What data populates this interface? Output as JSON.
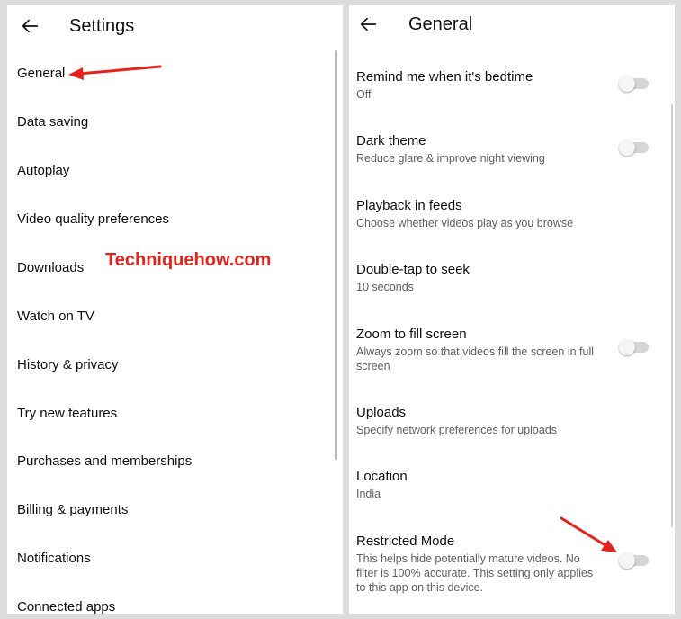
{
  "left": {
    "title": "Settings",
    "items": [
      {
        "label": "General"
      },
      {
        "label": "Data saving"
      },
      {
        "label": "Autoplay"
      },
      {
        "label": "Video quality preferences"
      },
      {
        "label": "Downloads"
      },
      {
        "label": "Watch on TV"
      },
      {
        "label": "History & privacy"
      },
      {
        "label": "Try new features"
      },
      {
        "label": "Purchases and memberships"
      },
      {
        "label": "Billing & payments"
      },
      {
        "label": "Notifications"
      },
      {
        "label": "Connected apps"
      }
    ]
  },
  "right": {
    "title": "General",
    "settings": [
      {
        "title": "Remind me when it's bedtime",
        "subtitle": "Off"
      },
      {
        "title": "Dark theme",
        "subtitle": "Reduce glare & improve night viewing"
      },
      {
        "title": "Playback in feeds",
        "subtitle": "Choose whether videos play as you browse"
      },
      {
        "title": "Double-tap to seek",
        "subtitle": "10 seconds"
      },
      {
        "title": "Zoom to fill screen",
        "subtitle": "Always zoom so that videos fill the screen in full screen"
      },
      {
        "title": "Uploads",
        "subtitle": "Specify network preferences for uploads"
      },
      {
        "title": "Location",
        "subtitle": "India"
      },
      {
        "title": "Restricted Mode",
        "subtitle": "This helps hide potentially mature videos. No filter is 100% accurate. This setting only applies to this app on this device."
      }
    ]
  },
  "watermark": "Techniquehow.com",
  "icons": {
    "back": "arrow-left-icon",
    "annotation": "red-arrow-icon"
  },
  "colors": {
    "annotation": "#e5231b",
    "toggle_off_track": "#d6d6d6",
    "secondary_text": "#606060"
  }
}
